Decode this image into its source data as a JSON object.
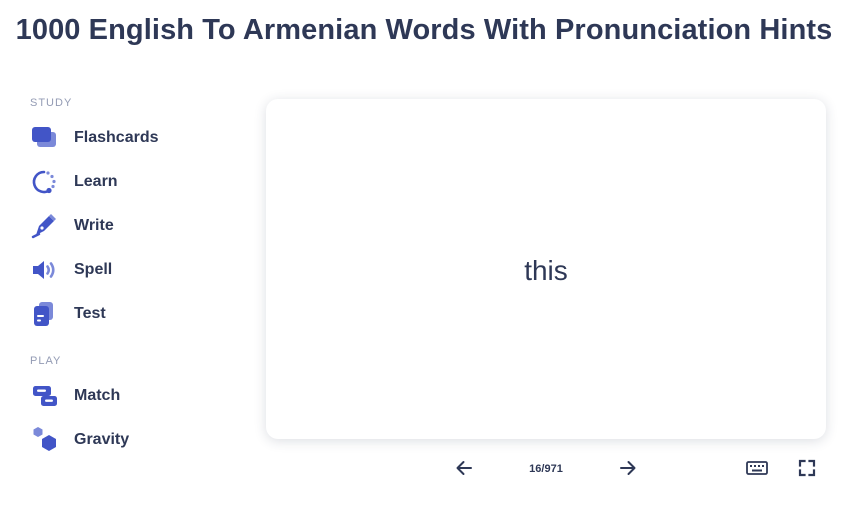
{
  "page": {
    "title": "1000 English To Armenian Words With Pronunciation Hints"
  },
  "sidebar": {
    "study_label": "STUDY",
    "study_items": [
      {
        "label": "Flashcards",
        "icon": "flashcards-icon"
      },
      {
        "label": "Learn",
        "icon": "learn-icon"
      },
      {
        "label": "Write",
        "icon": "write-icon"
      },
      {
        "label": "Spell",
        "icon": "spell-icon"
      },
      {
        "label": "Test",
        "icon": "test-icon"
      }
    ],
    "play_label": "PLAY",
    "play_items": [
      {
        "label": "Match",
        "icon": "match-icon"
      },
      {
        "label": "Gravity",
        "icon": "gravity-icon"
      }
    ]
  },
  "card": {
    "term": "this"
  },
  "controls": {
    "counter": "16/971",
    "prev_icon": "arrow-left-icon",
    "next_icon": "arrow-right-icon",
    "keyboard_icon": "keyboard-icon",
    "fullscreen_icon": "fullscreen-icon"
  },
  "colors": {
    "accent": "#4255c7",
    "accent_light": "#7b89d9",
    "text": "#2e3856",
    "muted": "#939bb4"
  }
}
